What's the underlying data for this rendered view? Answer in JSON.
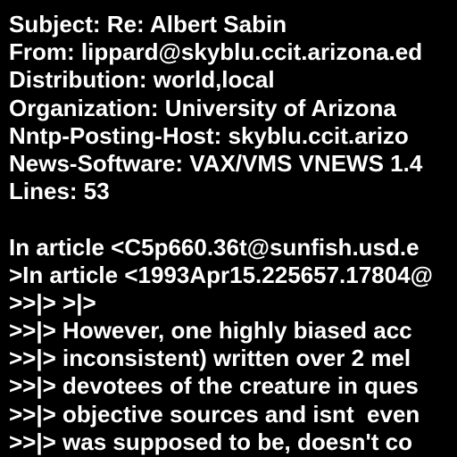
{
  "colors": {
    "background": "#000000",
    "text": "#ffffff"
  },
  "header": {
    "subject": "Subject: Re: Albert Sabin",
    "from": "From: lippard@skyblu.ccit.arizona.ed",
    "distribution": "Distribution: world,local",
    "organization": "Organization: University of Arizona",
    "nntp_host": "Nntp-Posting-Host: skyblu.ccit.arizo",
    "news_software": "News-Software: VAX/VMS VNEWS 1.4",
    "lines": "Lines: 53"
  },
  "body": {
    "lines": [
      "In article <C5p660.36t@sunfish.usd.e",
      ">In article <1993Apr15.225657.17804@",
      ">>|> >|>",
      ">>|> However, one highly biased acc",
      ">>|> inconsistent) written over 2 mel",
      ">>|> devotees of the creature in ques",
      ">>|> objective sources and isnt  even",
      ">>|> was supposed to be, doesn't co"
    ]
  }
}
